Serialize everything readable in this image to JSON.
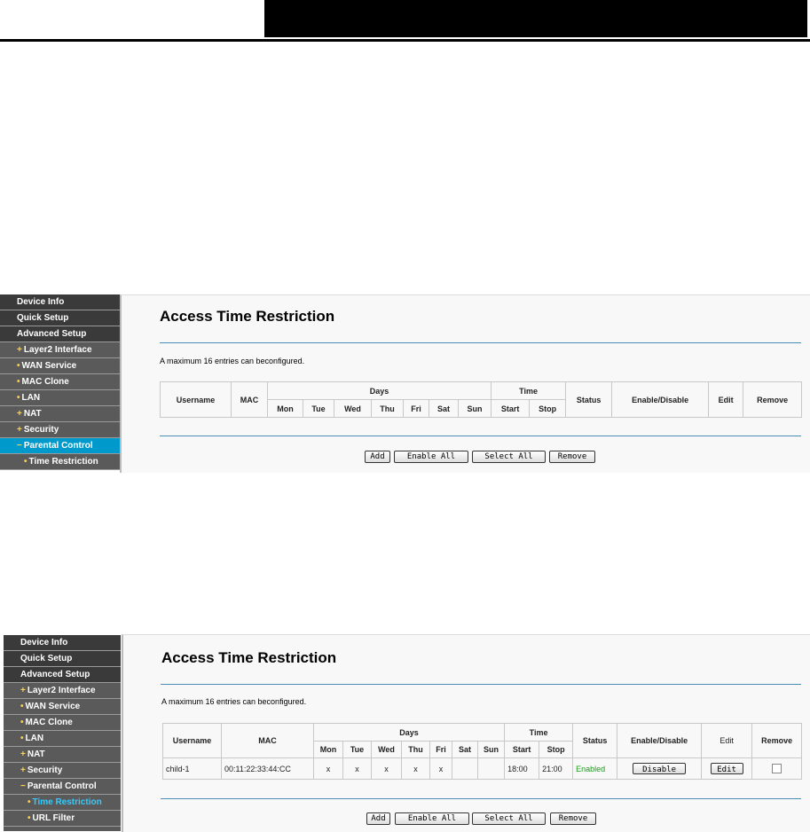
{
  "sidebar1": [
    "Device Info",
    "Quick Setup",
    "Advanced Setup",
    "Layer2 Interface",
    "WAN Service",
    "MAC Clone",
    "LAN",
    "NAT",
    "Security",
    "Parental Control",
    "Time Restriction"
  ],
  "sidebar2": [
    "Device Info",
    "Quick Setup",
    "Advanced Setup",
    "Layer2 Interface",
    "WAN Service",
    "MAC Clone",
    "LAN",
    "NAT",
    "Security",
    "Parental Control",
    "Time Restriction",
    "URL Filter"
  ],
  "title": "Access Time Restriction",
  "note": "A maximum 16 entries can beconfigured.",
  "headers": {
    "username": "Username",
    "mac": "MAC",
    "days": "Days",
    "mon": "Mon",
    "tue": "Tue",
    "wed": "Wed",
    "thu": "Thu",
    "fri": "Fri",
    "sat": "Sat",
    "sun": "Sun",
    "time": "Time",
    "start": "Start",
    "stop": "Stop",
    "status": "Status",
    "enable_disable": "Enable/Disable",
    "edit": "Edit",
    "remove": "Remove"
  },
  "row": {
    "username": "child-1",
    "mac": "00:11:22:33:44:CC",
    "mon": "x",
    "tue": "x",
    "wed": "x",
    "thu": "x",
    "fri": "x",
    "sat": "",
    "sun": "",
    "start": "18:00",
    "stop": "21:00",
    "status": "Enabled",
    "toggle": "Disable",
    "edit": "Edit"
  },
  "buttons": {
    "add": "Add",
    "enable_all": "Enable All",
    "select_all": "Select All",
    "remove": "Remove"
  },
  "colors": {
    "accent": "#0099cc",
    "enabled": "#1a9a1a"
  }
}
